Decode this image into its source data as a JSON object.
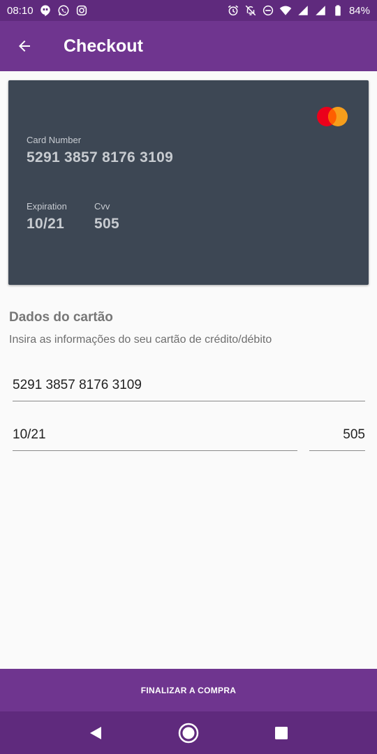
{
  "status_bar": {
    "time": "08:10",
    "battery": "84%",
    "left_icons": [
      "hangouts-icon",
      "whatsapp-icon",
      "instagram-icon"
    ],
    "right_icons": [
      "alarm-icon",
      "notifications-off-icon",
      "do-not-disturb-icon",
      "wifi-icon",
      "signal-icon",
      "signal-icon",
      "battery-icon"
    ]
  },
  "app_bar": {
    "title": "Checkout",
    "back_icon": "arrow-back-icon"
  },
  "card": {
    "brand_icon": "mastercard-icon",
    "number_label": "Card Number",
    "number": "5291 3857 8176 3109",
    "expiration_label": "Expiration",
    "expiration": "10/21",
    "cvv_label": "Cvv",
    "cvv": "505"
  },
  "form": {
    "title": "Dados do cartão",
    "subtitle": "Insira as informações do seu cartão de crédito/débito",
    "card_number_value": "5291 3857 8176 3109",
    "expiration_value": "10/21",
    "cvv_value": "505"
  },
  "finish_button": {
    "label": "FINALIZAR A COMPRA"
  },
  "nav_bar": {
    "icons": [
      "back-triangle-icon",
      "home-circle-icon",
      "recents-square-icon"
    ]
  },
  "colors": {
    "primary": "#6f358f",
    "primary_dark": "#5f2a7d",
    "card_background": "#3d4754",
    "mastercard_red": "#eb001b",
    "mastercard_orange": "#f79e1b"
  }
}
